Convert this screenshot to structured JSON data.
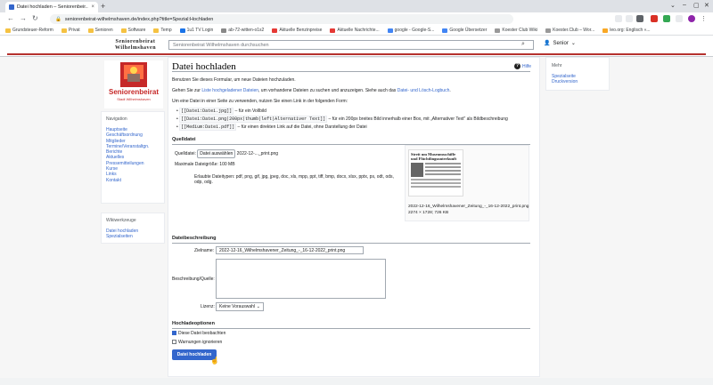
{
  "browser": {
    "tab_title": "Datei hochladen – Seniorenbeir...",
    "url": "seniorenbeirat-wilhelmshaven.de/index.php?title=Spezial:Hochladen",
    "bookmarks": [
      "Grundsteuer-Reform",
      "Privat",
      "Senioren",
      "Software",
      "Temp",
      "1u1 TV Login",
      "ab-72-witten-o1s2",
      "Aktuelle Benzinpreise",
      "Aktuelle Nachrichte...",
      "google - Google-S...",
      "Google Übersetzer",
      "Koester Club Wiki",
      "Koester.Club – Wor...",
      "leo.org: Englisch «..."
    ]
  },
  "site": {
    "logo_line1": "Seniorenbeirat",
    "logo_line2": "Wilhelmshaven",
    "search_placeholder": "Seniorenbeirat Wilhelmshaven durchsuchen",
    "user": "Senior",
    "logo_badge": "Seniorenbeirat",
    "logo_badge_sub": "Stadt Wilhelmshaven"
  },
  "nav": {
    "title": "Navigation",
    "items": [
      "Hauptseite",
      "Geschäftsordnung",
      "Mitglieder",
      "Termine/Veranstaltgn.",
      "Berichte",
      "Aktuelles",
      "Pressemitteilungen",
      "Kurse",
      "Links",
      "Kontakt"
    ]
  },
  "tools": {
    "title": "Wikiwerkzeuge",
    "items": [
      "Datei hochladen",
      "Spezialseiten"
    ]
  },
  "more": {
    "title": "Mehr",
    "items": [
      "Spezialseite",
      "Druckversion"
    ]
  },
  "page": {
    "title": "Datei hochladen",
    "help": "Hilfe",
    "intro1": "Benutzen Sie dieses Formular, um neue Dateien hochzuladen.",
    "intro2_pre": "Gehen Sie zur ",
    "intro2_link": "Liste hochgeladener Dateien",
    "intro2_mid": ", um vorhandene Dateien zu suchen und anzuzeigen. Siehe auch das ",
    "intro2_link2": "Datei- und Lösch-Logbuch",
    "intro2_end": ".",
    "intro3": "Um eine Datei in einer Seite zu verwenden, nutzen Sie einen Link in der folgenden Form:",
    "ex1_code": "[[Datei:Datei.jpg]]",
    "ex1_text": " – für ein Vollbild",
    "ex2_code": "[[Datei:Datei.png|200px|thumb|left|Alternativer Text]]",
    "ex2_text": " – für ein 200px breites Bild innerhalb einer Box, mit „Alternativer Text\" als Bildbeschreibung",
    "ex3_code": "[[Medium:Datei.pdf]]",
    "ex3_text": " – für einen direkten Link auf die Datei, ohne Darstellung der Datei"
  },
  "source": {
    "heading": "Quelldatei",
    "file_label": "Quelldatei:",
    "choose_button": "Datei auswählen",
    "chosen_file": "2022-12-..._print.png",
    "max_size": "Maximale Dateigröße: 100 MB",
    "allowed_types": "Erlaubte Dateitypen: pdf, png, gif, jpg, jpeg, doc, xls, mpp, ppt, tiff, bmp, docx, xlsx, pptx, ps, odt, ods, odp, odg.",
    "preview_headline": "Streit um Museumsschiffe und Flüchtlingsunterkunft",
    "preview_name": "2022-12-16_Wilhelmshavener_Zeitung_-_16-12-2022_print.png",
    "preview_meta": "2274 × 1728; 726 KB"
  },
  "description": {
    "heading": "Dateibeschreibung",
    "target_label": "Zielname:",
    "target_value": "2022-12-16_Wilhelmshavener_Zeitung_-_16-12-2022_print.png",
    "desc_label": "Beschreibung/Quelle:",
    "license_label": "Lizenz:",
    "license_value": "Keine Vorauswahl"
  },
  "options": {
    "heading": "Hochladeoptionen",
    "watch_label": "Diese Datei beobachten",
    "ignore_label": "Warnungen ignorieren",
    "upload_button": "Datei hochladen"
  }
}
